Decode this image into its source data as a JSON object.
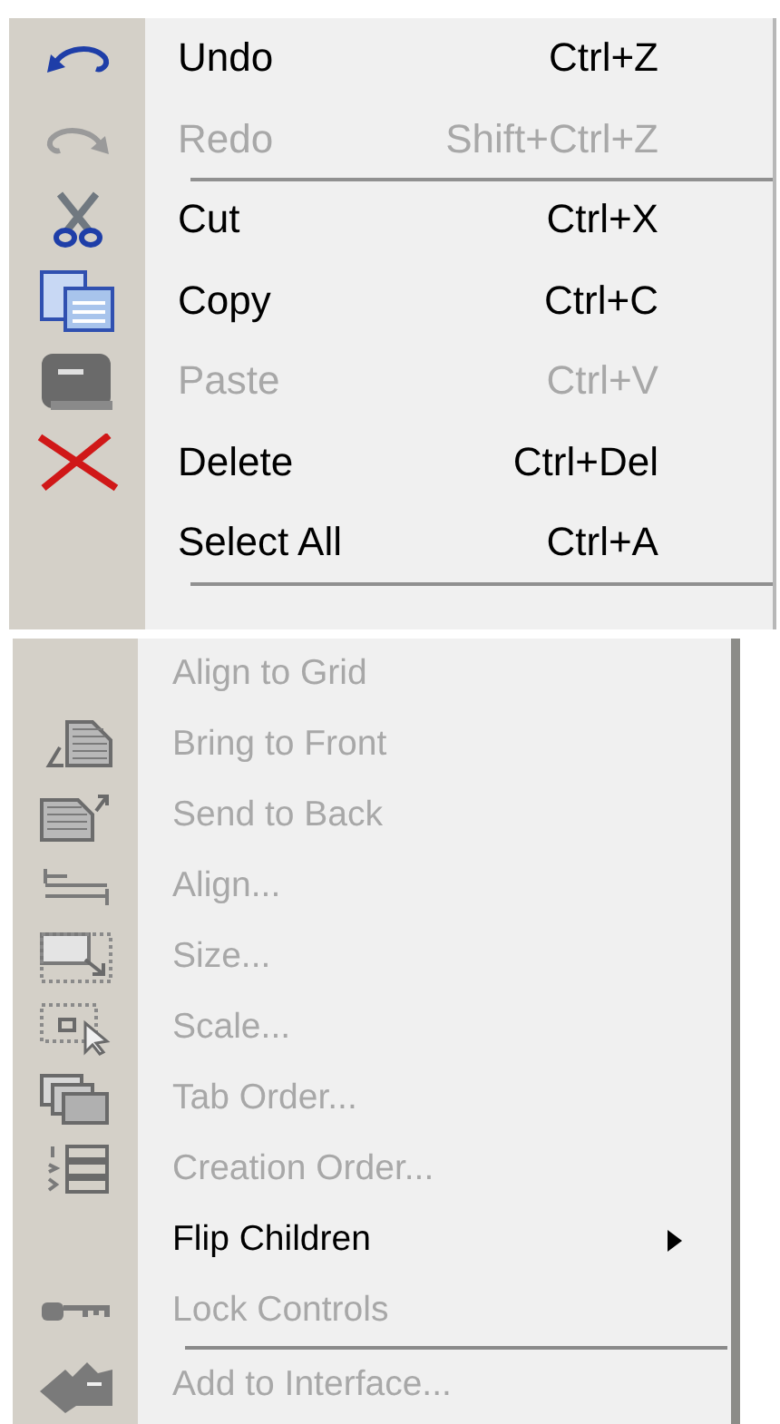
{
  "menus": [
    {
      "items": [
        {
          "kind": "item",
          "label": "Undo",
          "shortcut": "Ctrl+Z",
          "disabled": false
        },
        {
          "kind": "item",
          "label": "Redo",
          "shortcut": "Shift+Ctrl+Z",
          "disabled": true
        },
        {
          "kind": "separator"
        },
        {
          "kind": "item",
          "label": "Cut",
          "shortcut": "Ctrl+X",
          "disabled": false
        },
        {
          "kind": "item",
          "label": "Copy",
          "shortcut": "Ctrl+C",
          "disabled": false
        },
        {
          "kind": "item",
          "label": "Paste",
          "shortcut": "Ctrl+V",
          "disabled": true
        },
        {
          "kind": "item",
          "label": "Delete",
          "shortcut": "Ctrl+Del",
          "disabled": false
        },
        {
          "kind": "item",
          "label": "Select All",
          "shortcut": "Ctrl+A",
          "disabled": false
        },
        {
          "kind": "separator"
        }
      ]
    },
    {
      "items": [
        {
          "kind": "item",
          "label": "Align to Grid",
          "disabled": true
        },
        {
          "kind": "item",
          "label": "Bring to Front",
          "disabled": true
        },
        {
          "kind": "item",
          "label": "Send to Back",
          "disabled": true
        },
        {
          "kind": "item",
          "label": "Align...",
          "disabled": true
        },
        {
          "kind": "item",
          "label": "Size...",
          "disabled": true
        },
        {
          "kind": "item",
          "label": "Scale...",
          "disabled": true
        },
        {
          "kind": "item",
          "label": "Tab Order...",
          "disabled": true
        },
        {
          "kind": "item",
          "label": "Creation Order...",
          "disabled": true
        },
        {
          "kind": "item",
          "label": "Flip Children",
          "disabled": false,
          "submenu": true
        },
        {
          "kind": "item",
          "label": "Lock Controls",
          "disabled": true
        },
        {
          "kind": "separator"
        },
        {
          "kind": "item",
          "label": "Add to Interface...",
          "disabled": true
        }
      ]
    }
  ]
}
